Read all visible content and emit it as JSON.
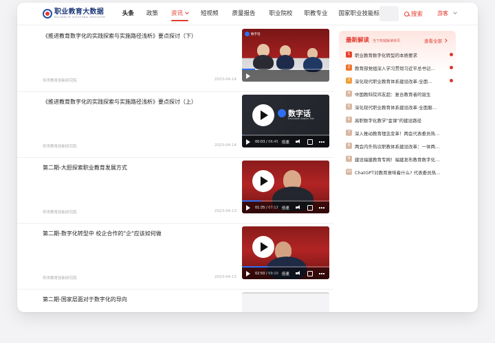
{
  "header": {
    "logo": {
      "title": "职业教育大数据",
      "subtitle": "BIG DATA OF VOCATIONAL EDUCATION"
    },
    "nav": [
      {
        "label": "头条"
      },
      {
        "label": "政策"
      },
      {
        "label": "资讯"
      },
      {
        "label": "短视频"
      },
      {
        "label": "质量报告"
      },
      {
        "label": "职业院校"
      },
      {
        "label": "职教专业"
      },
      {
        "label": "国家职业技能标准"
      }
    ],
    "active_nav": "资讯",
    "search_label": "搜索",
    "guest_label": "游客"
  },
  "articles": [
    {
      "title": "《推进教育数字化的实践探索与实施路径浅析》要点探讨（下）",
      "source": "传世教育创新研究院",
      "date": "2023-04-14",
      "video": {
        "style": "meeting",
        "brand": "数字话",
        "brand_sub": "",
        "time_current": "",
        "time_total": "",
        "speed": "",
        "progress": 0.15
      }
    },
    {
      "title": "《推进教育数字化的实践探索与实施路径浅析》要点探讨（上）",
      "source": "传世教育创新研究院",
      "date": "2023-04-14",
      "video": {
        "style": "dark",
        "brand": "数字话",
        "brand_sub": "Education Digital Talk",
        "time_current": "00:03",
        "time_total": "06:45",
        "speed": "倍速",
        "progress": 0.01
      }
    },
    {
      "title": "第二期-大胆探索职业教育发展方式",
      "source": "传世教育创新研究院",
      "date": "2023-04-13",
      "video": {
        "style": "scene",
        "brand": "",
        "brand_sub": "",
        "time_current": "01:35",
        "time_total": "07:13",
        "speed": "倍速",
        "progress": 0.22
      }
    },
    {
      "title": "第二期-数字化转型中 校企合作的\"企\"应该如何做",
      "source": "传世教育创新研究院",
      "date": "2023-04-13",
      "video": {
        "style": "scene",
        "brand": "",
        "brand_sub": "",
        "time_current": "02:50",
        "time_total": "09:10",
        "speed": "倍速",
        "progress": 0.31
      }
    },
    {
      "title": "第二期-国家层面对于数字化的导向",
      "source": "",
      "date": "",
      "video": {
        "style": "scene",
        "brand": "",
        "brand_sub": "",
        "time_current": "",
        "time_total": "",
        "speed": "",
        "progress": 0
      }
    }
  ],
  "sidebar": {
    "title": "最新解读",
    "subtitle": "当下权威解读资讯",
    "view_all": "查看全部",
    "items": [
      {
        "rank": "1",
        "text": "职业教育数字化转型的本质要求",
        "hot": true
      },
      {
        "rank": "2",
        "text": "教育部党组深入学习贯彻习近平总书记…",
        "hot": true
      },
      {
        "rank": "3",
        "text": "深化现代职业教育体系建设改革:全面…",
        "hot": true
      },
      {
        "rank": "4",
        "text": "中国教科院邓友超：复合教育者的诞生",
        "hot": false
      },
      {
        "rank": "5",
        "text": "深化现代职业教育体系建设改革:全面服…",
        "hot": false
      },
      {
        "rank": "6",
        "text": "高职数字化教学\"金课\"的建设路径",
        "hot": false
      },
      {
        "rank": "7",
        "text": "深入推动教育理念变革！两会代表委员热…",
        "hot": false
      },
      {
        "rank": "8",
        "text": "两会内外热议职教体系建设改革：一体两…",
        "hot": false
      },
      {
        "rank": "9",
        "text": "建设福建教育专网！福建发布教育数字化…",
        "hot": false
      },
      {
        "rank": "10",
        "text": "ChatGPT对教育意味着什么? 代表委员热…",
        "hot": false
      }
    ],
    "rank_colors": {
      "top": "#e8452c",
      "second": "#f0742e",
      "third": "#f29f3a",
      "rest": "#d9b8a3"
    }
  }
}
